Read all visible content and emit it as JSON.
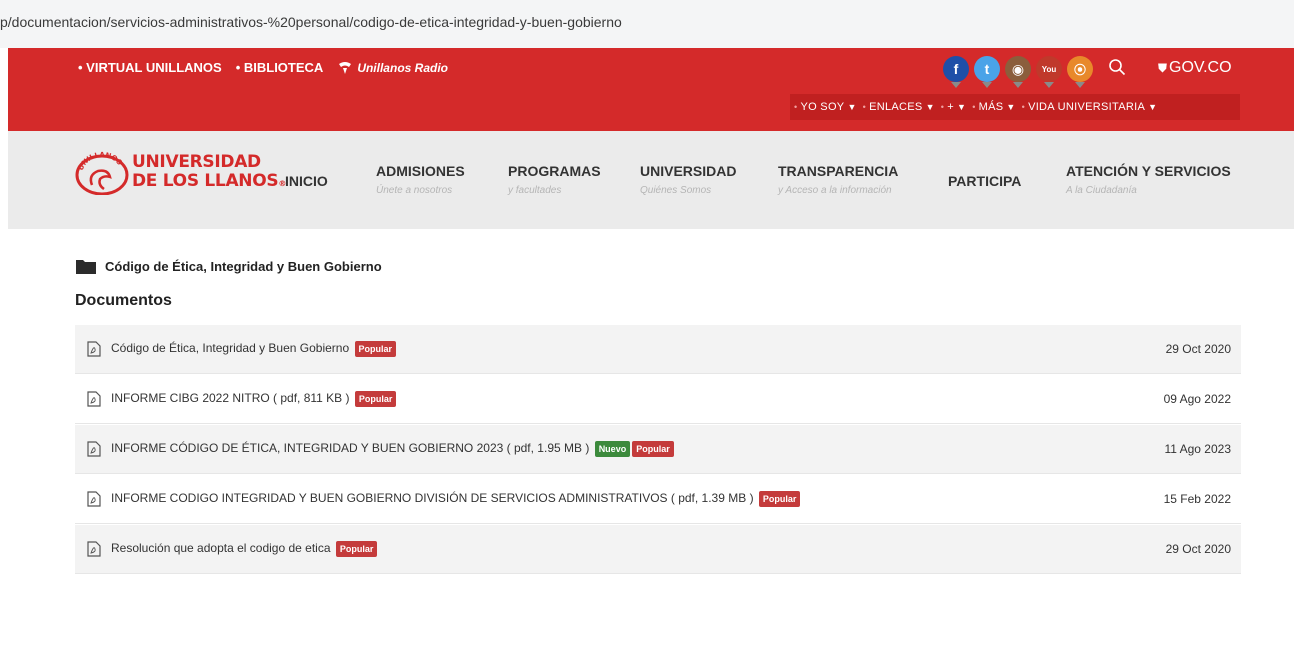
{
  "browser": {
    "url": "p/documentacion/servicios-administrativos-%20personal/codigo-de-etica-integridad-y-buen-gobierno"
  },
  "topbar": {
    "links": [
      "• VIRTUAL UNILLANOS",
      "• BIBLIOTECA"
    ],
    "radio_label": "Unillanos Radio",
    "social": [
      {
        "icon": "facebook-icon",
        "glyph": "f"
      },
      {
        "icon": "twitter-icon",
        "glyph": "t"
      },
      {
        "icon": "instagram-icon",
        "glyph": "◉"
      },
      {
        "icon": "youtube-icon",
        "glyph": "You"
      },
      {
        "icon": "rss-icon",
        "glyph": "⦿"
      }
    ],
    "gov_label": "GOV.CO",
    "subnav": [
      "YO SOY",
      "ENLACES",
      "+",
      "MÁS",
      "VIDA UNIVERSITARIA"
    ]
  },
  "logo": {
    "line1": "UNIVERSIDAD",
    "line2": "DE LOS LLANOS",
    "seal_text": "UNILLANOS"
  },
  "nav": [
    {
      "title": "INICIO",
      "subtitle": ""
    },
    {
      "title": "ADMISIONES",
      "subtitle": "Únete a nosotros"
    },
    {
      "title": "PROGRAMAS",
      "subtitle": "y facultades"
    },
    {
      "title": "UNIVERSIDAD",
      "subtitle": "Quiénes Somos"
    },
    {
      "title": "TRANSPARENCIA",
      "subtitle": "y Acceso a la información"
    },
    {
      "title": "PARTICIPA",
      "subtitle": ""
    },
    {
      "title": "ATENCIÓN Y SERVICIOS",
      "subtitle": "A la Ciudadanía"
    }
  ],
  "category": {
    "label": "Código de Ética, Integridad y Buen Gobierno"
  },
  "section_title": "Documentos",
  "documents": [
    {
      "title": "Código de Ética, Integridad y Buen Gobierno",
      "new": "",
      "popular": "Popular",
      "date": "29 Oct 2020"
    },
    {
      "title": "INFORME CIBG 2022 NITRO ( pdf, 811 KB )",
      "new": "",
      "popular": "Popular",
      "date": "09 Ago 2022"
    },
    {
      "title": "INFORME CÓDIGO DE ÉTICA, INTEGRIDAD Y BUEN GOBIERNO 2023 ( pdf, 1.95 MB )",
      "new": "Nuevo",
      "popular": "Popular",
      "date": "11 Ago 2023"
    },
    {
      "title": "INFORME CODIGO INTEGRIDAD Y BUEN GOBIERNO DIVISIÓN DE SERVICIOS ADMINISTRATIVOS ( pdf, 1.39 MB )",
      "new": "",
      "popular": "Popular",
      "date": "15 Feb 2022"
    },
    {
      "title": "Resolución que adopta el codigo de etica",
      "new": "",
      "popular": "Popular",
      "date": "29 Oct 2020"
    }
  ],
  "colors": {
    "brand_red": "#d42a2a",
    "popular_badge": "#c43b3b",
    "new_badge": "#3c8a3c"
  }
}
